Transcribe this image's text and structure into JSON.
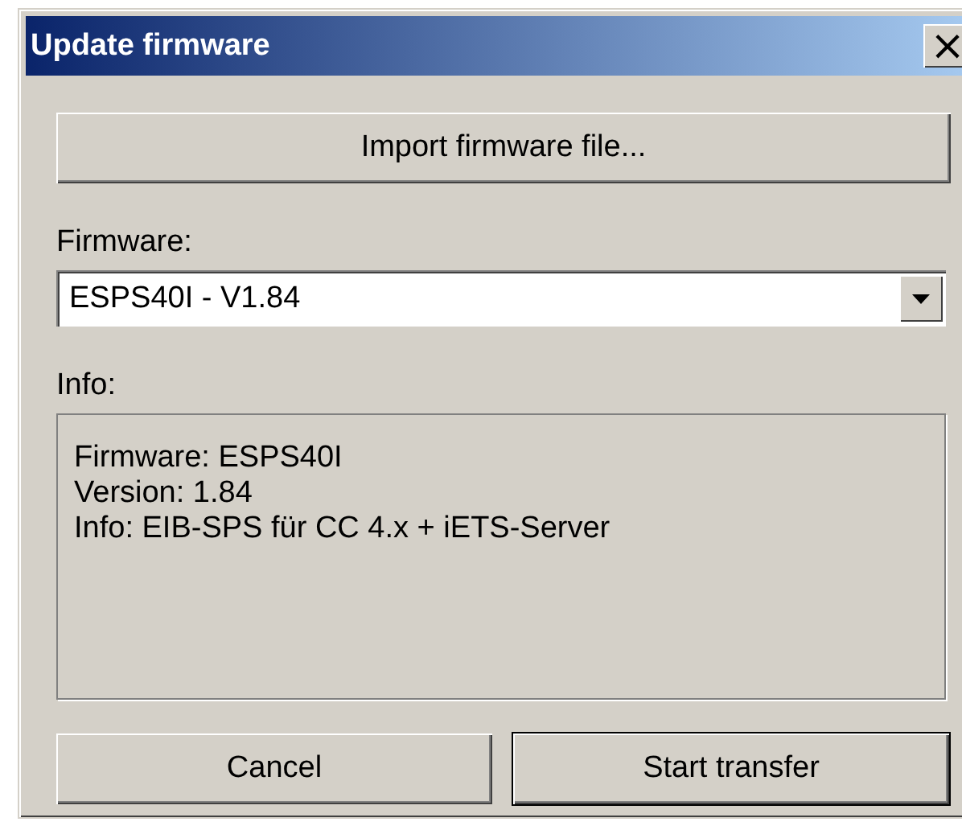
{
  "window": {
    "title": "Update firmware",
    "close": "×"
  },
  "import_button": {
    "label": "Import firmware file..."
  },
  "firmware": {
    "label": "Firmware:",
    "value": "ESPS40I - V1.84"
  },
  "info": {
    "label": "Info:",
    "lines": [
      "Firmware: ESPS40I",
      "Version: 1.84",
      "Info: EIB-SPS für CC 4.x  + iETS-Server"
    ]
  },
  "buttons": [
    {
      "label": "Cancel",
      "default": false
    },
    {
      "label": "Start transfer",
      "default": true
    }
  ]
}
